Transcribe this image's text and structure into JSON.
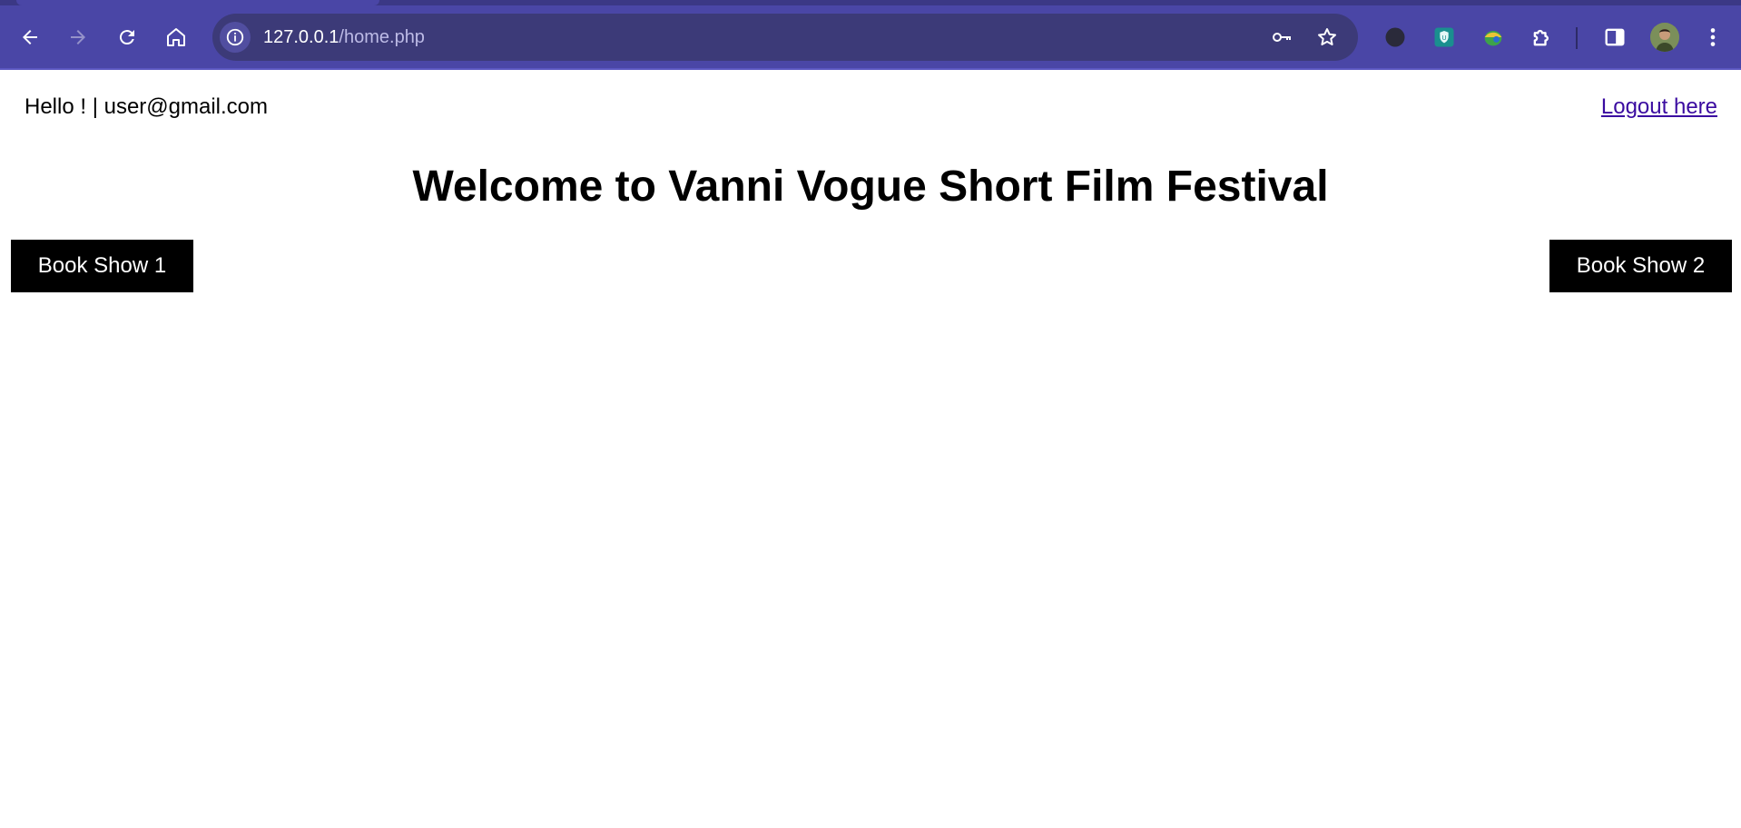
{
  "browser": {
    "url_host": "127.0.0.1",
    "url_path": "/home.php",
    "icons": {
      "back": "arrow-left-icon",
      "forward": "arrow-right-icon",
      "reload": "reload-icon",
      "home": "home-icon",
      "site_info": "info-icon",
      "password": "key-icon",
      "bookmark": "star-icon",
      "extensions": [
        "extension-moon-icon",
        "extension-shield-icon",
        "extension-globe-icon",
        "puzzle-icon"
      ],
      "side_panel": "side-panel-icon",
      "menu": "kebab-menu-icon"
    },
    "colors": {
      "toolbar": "#4a46a6",
      "omnibox": "#3c3a78"
    }
  },
  "header": {
    "greeting": "Hello ! | user@gmail.com",
    "logout_label": "Logout here"
  },
  "main": {
    "title": "Welcome to Vanni Vogue Short Film Festival",
    "buttons": [
      {
        "label": "Book Show 1"
      },
      {
        "label": "Book Show 2"
      }
    ]
  }
}
